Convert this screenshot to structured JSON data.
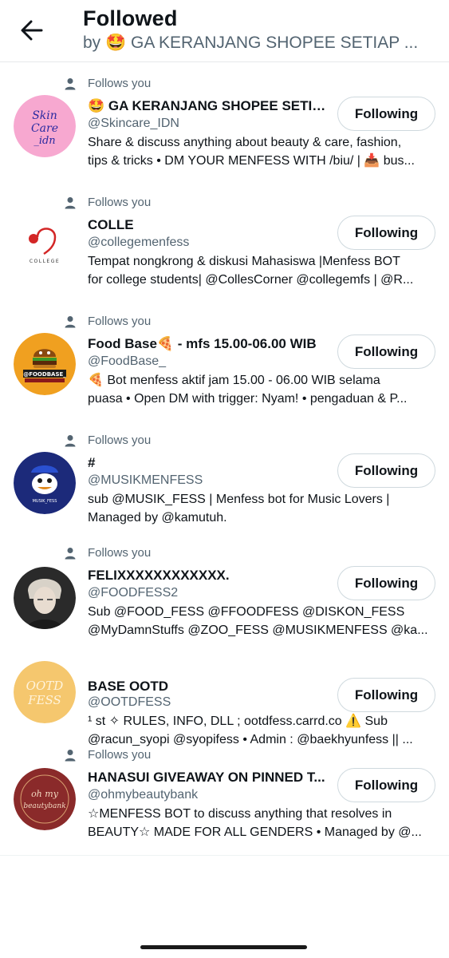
{
  "header": {
    "title": "Followed",
    "subtitle": "by 🤩 GA KERANJANG SHOPEE SETIAP ...",
    "back_icon": "arrow-left-icon"
  },
  "follows_label": "Follows you",
  "accounts": [
    {
      "name": "🤩 GA KERANJANG SHOPEE SETIAP...",
      "handle": "@Skincare_IDN",
      "bio_line1": "Share & discuss anything about beauty & care, fashion,",
      "bio_line2": "tips & tricks • DM YOUR MENFESS WITH /biu/ | 📥 bus...",
      "button": "Following",
      "show_follows": true,
      "avatar_text": "Skin Care idn",
      "avatar_color": "#f7a8d0"
    },
    {
      "name": "COLLE",
      "handle": "@collegemenfess",
      "bio_line1": "Tempat nongkrong & diskusi Mahasiswa |Menfess BOT",
      "bio_line2": "for college students| @CollesCorner @collegemfs | @R...",
      "button": "Following",
      "show_follows": true,
      "avatar_text": "COLLEGE",
      "avatar_color": "#ffffff"
    },
    {
      "name": "Food Base🍕 - mfs 15.00-06.00 WIB",
      "handle": "@FoodBase_",
      "bio_line1": "🍕 Bot menfess aktif jam 15.00 - 06.00 WIB selama",
      "bio_line2": "puasa  • Open DM with trigger: Nyam! • pengaduan & P...",
      "button": "Following",
      "show_follows": true,
      "avatar_text": "@FOODBASE_",
      "avatar_subtext": "MENFESS FOR YOUR FOOD",
      "avatar_color": "#f0a020"
    },
    {
      "name": "#",
      "handle": "@MUSIKMENFESS",
      "bio_line1": "sub @MUSIK_FESS | Menfess bot for Music Lovers |",
      "bio_line2": "Managed by @kamutuh.",
      "button": "Following",
      "show_follows": true,
      "avatar_text": "MUSIK_FESS",
      "avatar_color": "#1c2a7a"
    },
    {
      "name": "FELIXXXXXXXXXXXX.",
      "handle": "@FOODFESS2",
      "bio_line1": "Sub @FOOD_FESS @FFOODFESS @DISKON_FESS",
      "bio_line2": "@MyDamnStuffs @ZOO_FESS @MUSIKMENFESS @ka...",
      "button": "Following",
      "show_follows": true,
      "avatar_text": "",
      "avatar_color": "#2a2a2a"
    },
    {
      "name": "BASE OOTD",
      "handle": "@OOTDFESS",
      "bio_line1": "¹ st ✧ RULES, INFO, DLL ; ootdfess.carrd.co ⚠️ Sub",
      "bio_line2": "@racun_syopi @syopifess • Admin : @baekhyunfess || ...",
      "button": "Following",
      "show_follows": false,
      "avatar_text": "OOTD FESS",
      "avatar_color": "#f5c76e"
    },
    {
      "name": "HANASUI GIVEAWAY ON PINNED T...",
      "handle": "@ohmybeautybank",
      "bio_line1": "☆MENFESS BOT to discuss anything that resolves in",
      "bio_line2": "BEAUTY☆ MADE FOR ALL GENDERS • Managed by @...",
      "button": "Following",
      "show_follows": true,
      "avatar_text": "oh my beautybank",
      "avatar_color": "#8a2a2a"
    }
  ]
}
